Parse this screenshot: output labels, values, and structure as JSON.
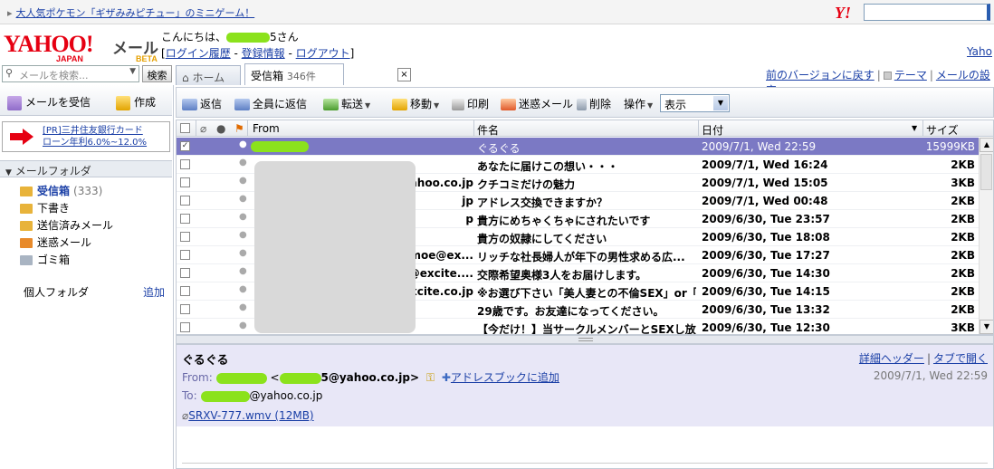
{
  "topbar": {
    "promo_link": "大人気ポケモン「ギザみみピチュー」のミニゲーム！",
    "promo_arrow": "▸",
    "yahoo_icon": "Y!"
  },
  "header": {
    "logo_text": "YAHOO!",
    "logo_sub": "JAPAN",
    "mail_text": "メール",
    "beta_text": "BETA",
    "greeting_prefix": "こんにちは、",
    "greeting_suffix": "5さん",
    "bracket_open": "[",
    "bracket_close": "]",
    "login_history": "ログイン履歴",
    "registration": "登録情報",
    "logout": "ログアウト",
    "dash": " - ",
    "yahoo_link": "Yaho"
  },
  "search": {
    "placeholder": "メールを検索...",
    "button": "検索"
  },
  "tabs": {
    "home": "ホーム",
    "inbox": "受信箱",
    "inbox_count": "346件",
    "close": "×"
  },
  "right_links": {
    "prev_version": "前のバージョンに戻す",
    "theme": "テーマ",
    "settings": "メールの設定"
  },
  "left_actions": {
    "receive": "メールを受信",
    "compose": "作成"
  },
  "ad": {
    "line1": "[PR]三井住友銀行カード",
    "line2": "ローン年利6.0%~12.0%"
  },
  "folders": {
    "header": "メールフォルダ",
    "items": [
      {
        "label": "受信箱",
        "count": "(333)"
      },
      {
        "label": "下書き",
        "count": ""
      },
      {
        "label": "送信済みメール",
        "count": ""
      },
      {
        "label": "迷惑メール",
        "count": ""
      },
      {
        "label": "ゴミ箱",
        "count": ""
      }
    ],
    "personal": "個人フォルダ",
    "personal_add": "追加"
  },
  "toolbar": {
    "reply": "返信",
    "reply_all": "全員に返信",
    "forward": "転送",
    "move": "移動",
    "print": "印刷",
    "spam": "迷惑メール",
    "delete": "削除",
    "actions": "操作",
    "view": "表示"
  },
  "list": {
    "headers": {
      "from": "From",
      "subject": "件名",
      "date": "日付",
      "size": "サイズ"
    },
    "rows": [
      {
        "from": "",
        "subject": "ぐるぐる",
        "date": "2009/7/1, Wed 22:59",
        "size": "15999KB"
      },
      {
        "from": "",
        "subject": "あなたに届けこの想い・・・",
        "date": "2009/7/1, Wed 16:24",
        "size": "2KB"
      },
      {
        "from": "yahoo.co.jp",
        "subject": "クチコミだけの魅力",
        "date": "2009/7/1, Wed 15:05",
        "size": "3KB"
      },
      {
        "from": "jp",
        "subject": "アドレス交換できますか？",
        "date": "2009/7/1, Wed 00:48",
        "size": "2KB"
      },
      {
        "from": "p",
        "subject": "貴方にめちゃくちゃにされたいです",
        "date": "2009/6/30, Tue 23:57",
        "size": "2KB"
      },
      {
        "from": "",
        "subject": "貴方の奴隷にしてください",
        "date": "2009/6/30, Tue 18:08",
        "size": "2KB"
      },
      {
        "from": "moe@ex...",
        "subject": "リッチな社長婦人が年下の男性求める広...",
        "date": "2009/6/30, Tue 17:27",
        "size": "2KB"
      },
      {
        "from": "e@excite....",
        "subject": "交際希望奥様3人をお届けします。",
        "date": "2009/6/30, Tue 14:30",
        "size": "2KB"
      },
      {
        "from": "xcite.co.jp",
        "subject": "※お選び下さい「美人妻との不倫SEX」or「...",
        "date": "2009/6/30, Tue 14:15",
        "size": "2KB"
      },
      {
        "from": "",
        "subject": "29歳です。お友達になってください。",
        "date": "2009/6/30, Tue 13:32",
        "size": "2KB"
      },
      {
        "from": "",
        "subject": "【今だけ！】当サークルメンバーとSEXし放...",
        "date": "2009/6/30, Tue 12:30",
        "size": "3KB"
      }
    ]
  },
  "preview": {
    "subject": "ぐるぐる",
    "detail_header": "詳細ヘッダー",
    "open_tab": "タブで開く",
    "from_label": "From:",
    "from_email_suffix": "5@yahoo.co.jp>",
    "from_lt": "<",
    "addressbook": "アドレスブックに追加",
    "date": "2009/7/1, Wed 22:59",
    "to_label": "To:",
    "to_email_suffix": "@yahoo.co.jp",
    "attachment": "SRXV-777.wmv (12MB)"
  },
  "colors": {
    "selected_row": "#7b79c4",
    "preview_bg": "#e8e7f7",
    "redaction_green": "#8be21c",
    "brand_red": "#e60012",
    "link_blue": "#1a3fa6"
  }
}
